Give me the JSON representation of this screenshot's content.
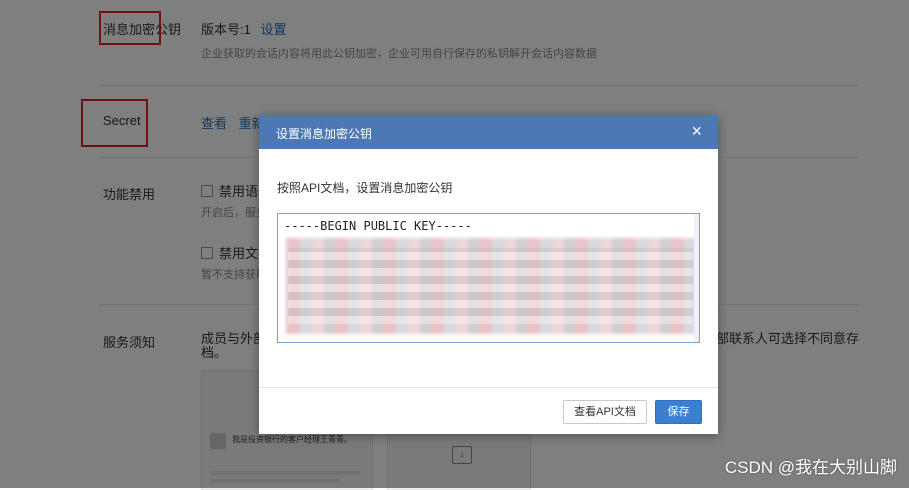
{
  "settings": {
    "key_row": {
      "label": "消息加密公钥",
      "version_text": "版本号:1",
      "set_link": "设置",
      "desc": "企业获取的会话内容将用此公钥加密，企业可用自行保存的私钥解开会话内容数据"
    },
    "secret_row": {
      "label": "Secret",
      "view_link": "查看",
      "reset_link": "重新"
    },
    "disable_row": {
      "label": "功能禁用",
      "opt1_label": "禁用语",
      "opt1_desc": "开启后，服务",
      "opt2_label": "禁用文",
      "opt2_desc": "暂不支持获取"
    },
    "service_row": {
      "label": "服务须知",
      "text_left": "成员与外部",
      "text_right": "部联系人可选择不同意存",
      "text_line2": "档。"
    },
    "preview": {
      "bubble_text": "我是投资银行的客户经理王青青。",
      "caption": "",
      "download_icon": "download-icon"
    }
  },
  "dialog": {
    "title": "设置消息加密公钥",
    "close_symbol": "×",
    "description": "按照API文档，设置消息加密公钥",
    "key_value": "-----BEGIN PUBLIC KEY-----",
    "view_api_doc_label": "查看API文档",
    "save_label": "保存"
  },
  "watermark": "CSDN @我在大别山脚",
  "colors": {
    "dialog_header": "#4c79b5",
    "primary_button": "#3a7fd0",
    "highlight_box": "#e02020",
    "link": "#2c6fb7"
  }
}
